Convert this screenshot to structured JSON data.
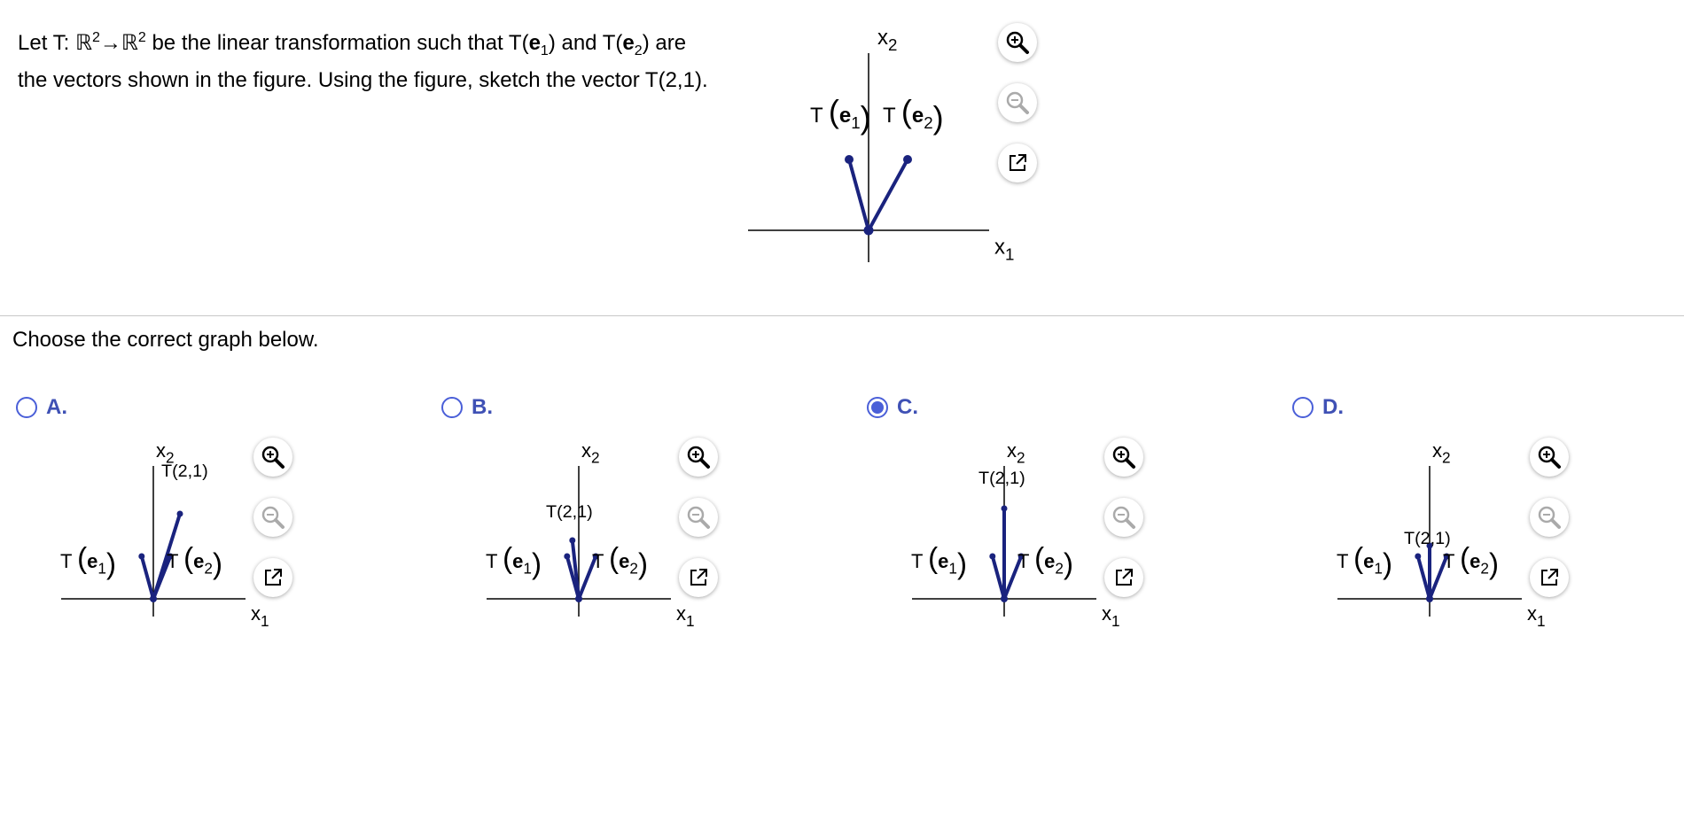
{
  "question": {
    "p1": "Let T: ",
    "r1": "ℝ",
    "exp1": "2",
    "arrow": "→",
    "r2": "ℝ",
    "exp2": "2",
    "p2": " be the linear transformation such that T(",
    "e": "e",
    "sub1": "1",
    "p3": ") and T(",
    "sub2": "2",
    "p4": ") are the vectors shown in the figure. Using the figure, sketch the vector T(2,1)."
  },
  "figure_labels": {
    "x1": "x",
    "x1_sub": "1",
    "x2": "x",
    "x2_sub": "2",
    "T": "T",
    "e": "e",
    "one": "1",
    "two": "2",
    "t21": "T(2,1)"
  },
  "icons": {
    "zoom_in": "zoom-in-icon",
    "zoom_out": "zoom-out-icon",
    "popout": "popout-icon"
  },
  "prompt": "Choose the correct graph below.",
  "options": [
    {
      "letter": "A.",
      "selected": false
    },
    {
      "letter": "B.",
      "selected": false
    },
    {
      "letter": "C.",
      "selected": true
    },
    {
      "letter": "D.",
      "selected": false
    }
  ],
  "colors": {
    "vector": "#1a237e",
    "radio": "#4a5fd8",
    "option_label": "#3f51b5"
  }
}
